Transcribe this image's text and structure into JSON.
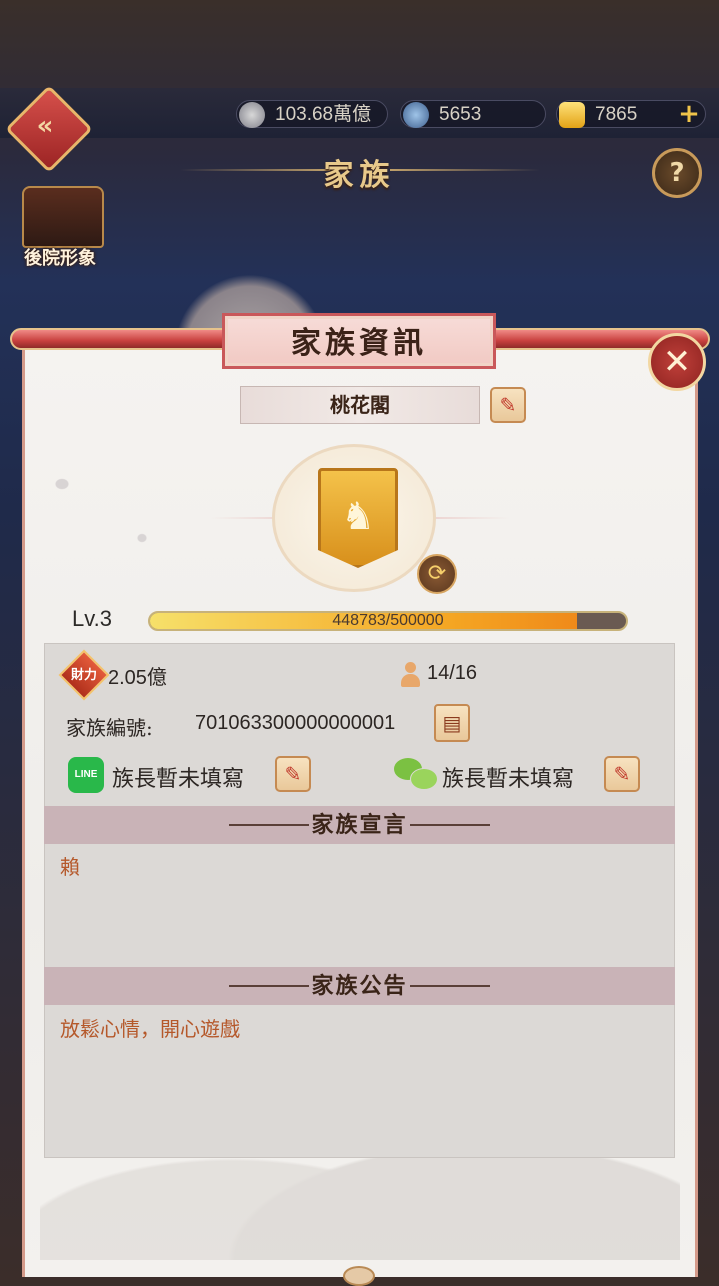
{
  "top_bar": {
    "resources": [
      {
        "icon": "coin-icon",
        "value": "103.68萬億"
      },
      {
        "icon": "gem-bag-icon",
        "value": "5653"
      },
      {
        "icon": "gold-ingot-icon",
        "value": "7865"
      }
    ]
  },
  "page_title": "家族",
  "side_button_label": "後院形象",
  "dialog": {
    "title": "家族資訊",
    "family_name": "桃花閣",
    "level": "Lv.3",
    "exp": {
      "current": 448783,
      "max": 500000,
      "text": "448783/500000"
    },
    "wealth_badge": "財力",
    "wealth": "2.05億",
    "members": "14/16",
    "id_label": "家族編號:",
    "id_value": "701063300000000001",
    "line_contact": "族長暫未填寫",
    "wechat_contact": "族長暫未填寫",
    "manifesto_header": "家族宣言",
    "manifesto_text": "賴",
    "notice_header": "家族公告",
    "notice_text": "放鬆心情，開心遊戲"
  },
  "colors": {
    "accent_red": "#c8403e",
    "gold": "#f5a623",
    "body_text": "#b5582a"
  }
}
